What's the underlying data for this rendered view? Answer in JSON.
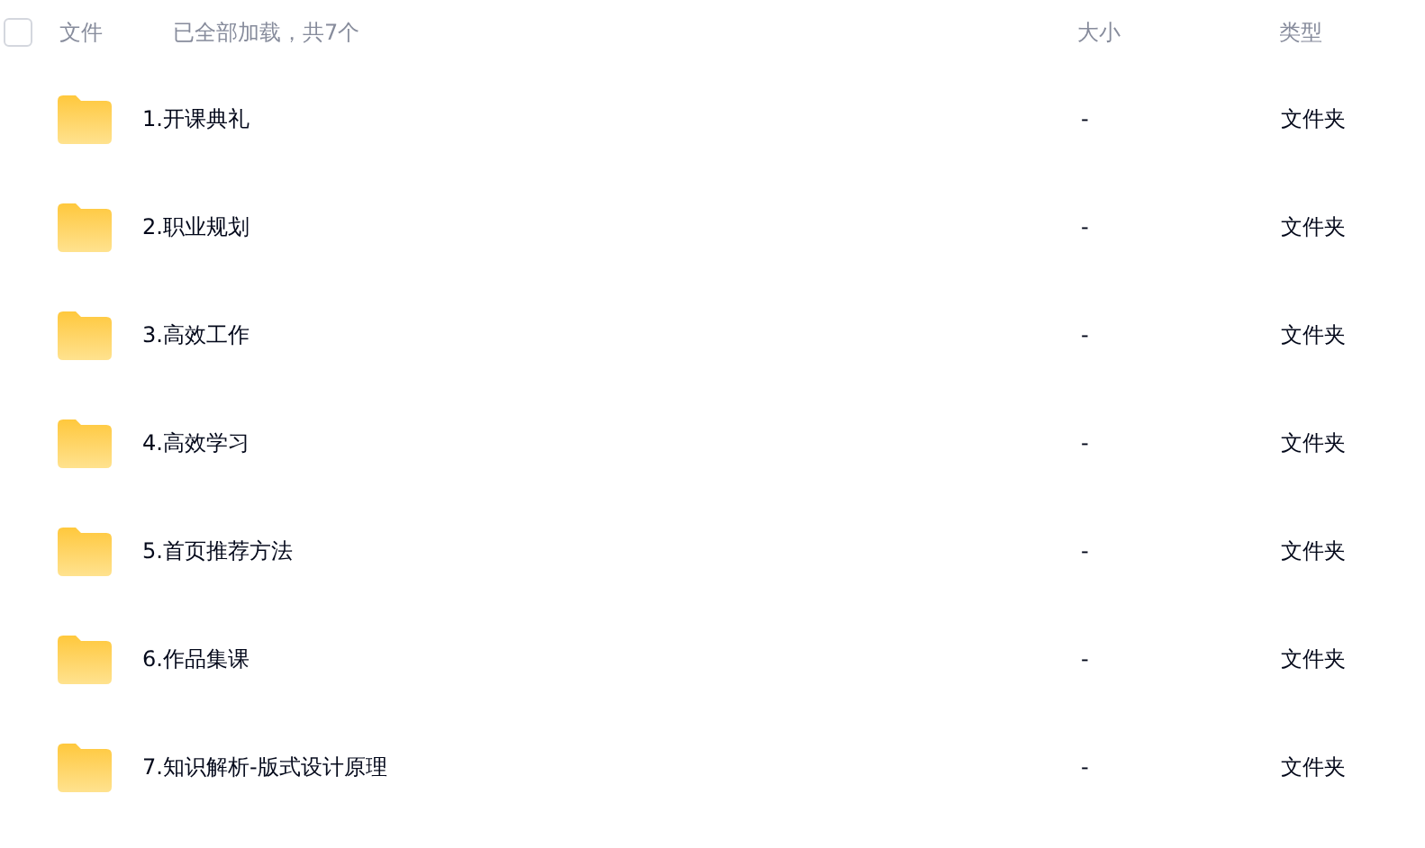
{
  "header": {
    "select_all": {
      "checked": false
    },
    "columns": [
      "文件",
      "大小",
      "类型"
    ],
    "status": "已全部加载，共7个"
  },
  "rows": [
    {
      "name": "1.开课典礼",
      "size": "-",
      "type": "文件夹"
    },
    {
      "name": "2.职业规划",
      "size": "-",
      "type": "文件夹"
    },
    {
      "name": "3.高效工作",
      "size": "-",
      "type": "文件夹"
    },
    {
      "name": "4.高效学习",
      "size": "-",
      "type": "文件夹"
    },
    {
      "name": "5.首页推荐方法",
      "size": "-",
      "type": "文件夹"
    },
    {
      "name": "6.作品集课",
      "size": "-",
      "type": "文件夹"
    },
    {
      "name": "7.知识解析-版式设计原理",
      "size": "-",
      "type": "文件夹"
    }
  ]
}
